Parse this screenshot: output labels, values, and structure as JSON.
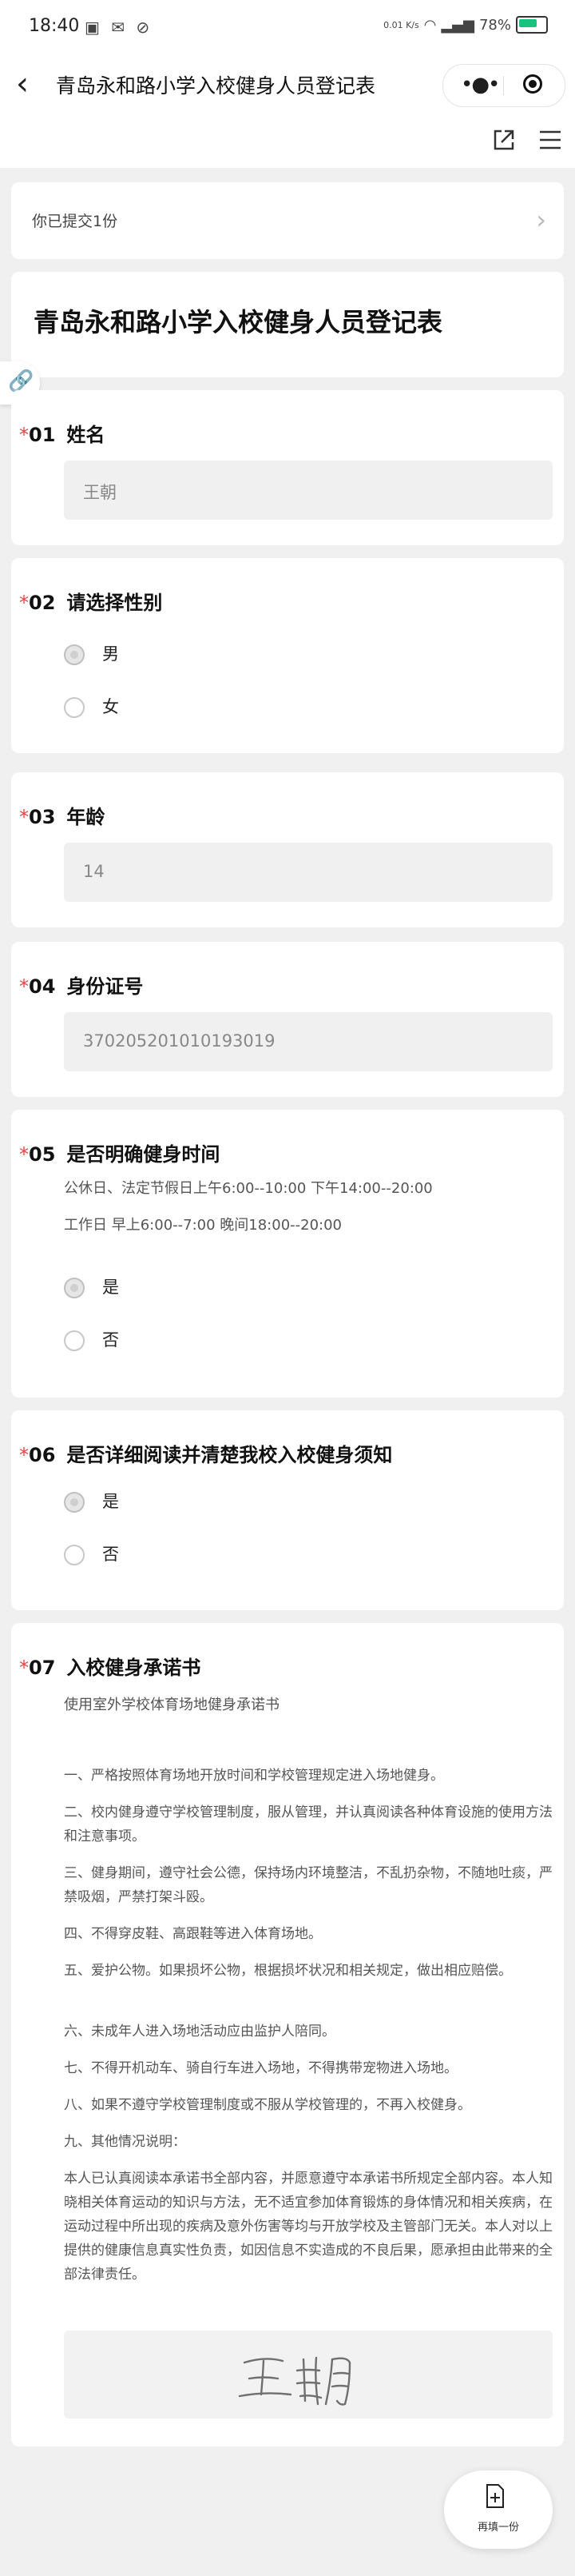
{
  "status_bar": {
    "time": "18:40",
    "network_speed": "0.01 K/s",
    "battery": "78%",
    "battery_level": 0.78
  },
  "nav": {
    "title": "青岛永和路小学入校健身人员登记表"
  },
  "submitted": {
    "text": "你已提交1份"
  },
  "form": {
    "title": "青岛永和路小学入校健身人员登记表",
    "q1": {
      "num": "01",
      "label": "姓名",
      "value": "王朝"
    },
    "q2": {
      "num": "02",
      "label": "请选择性别",
      "options": [
        "男",
        "女"
      ],
      "selected": "男"
    },
    "q3": {
      "num": "03",
      "label": "年龄",
      "value": "14"
    },
    "q4": {
      "num": "04",
      "label": "身份证号",
      "value": "370205201010193019"
    },
    "q5": {
      "num": "05",
      "label": "是否明确健身时间",
      "desc1": "公休日、法定节假日上午6:00--10:00   下午14:00--20:00",
      "desc2": "工作日  早上6:00--7:00  晚间18:00--20:00",
      "options": [
        "是",
        "否"
      ],
      "selected": "是"
    },
    "q6": {
      "num": "06",
      "label": "是否详细阅读并清楚我校入校健身须知",
      "options": [
        "是",
        "否"
      ],
      "selected": "是"
    },
    "q7": {
      "num": "07",
      "label": "入校健身承诺书",
      "subtitle": "使用室外学校体育场地健身承诺书",
      "items": [
        "一、严格按照体育场地开放时间和学校管理规定进入场地健身。",
        "二、校内健身遵守学校管理制度，服从管理，并认真阅读各种体育设施的使用方法和注意事项。",
        "三、健身期间，遵守社会公德，保持场内环境整洁，不乱扔杂物，不随地吐痰，严禁吸烟，严禁打架斗殴。",
        "四、不得穿皮鞋、高跟鞋等进入体育场地。",
        "五、爱护公物。如果损坏公物，根据损坏状况和相关规定，做出相应赔偿。",
        "六、未成年人进入场地活动应由监护人陪同。",
        "七、不得开机动车、骑自行车进入场地，不得携带宠物进入场地。",
        "八、如果不遵守学校管理制度或不服从学校管理的，不再入校健身。",
        "九、其他情况说明：",
        "本人已认真阅读本承诺书全部内容，并愿意遵守本承诺书所规定全部内容。本人知晓相关体育运动的知识与方法，无不适宜参加体育锻炼的身体情况和相关疾病，在运动过程中所出现的疾病及意外伤害等均与开放学校及主管部门无关。本人对以上提供的健康信息真实性负责，如因信息不实造成的不良后果，愿承担由此带来的全部法律责任。"
      ],
      "signature": "王朝"
    }
  },
  "fab": {
    "label": "再填一份"
  }
}
